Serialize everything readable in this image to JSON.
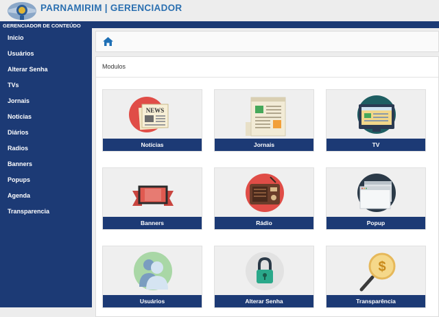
{
  "header": {
    "title": "PARNAMIRIM | GERENCIADOR"
  },
  "sidebar": {
    "title": "GERENCIADOR DE CONTEÚDO",
    "items": [
      {
        "label": "Inicio"
      },
      {
        "label": "Usuários"
      },
      {
        "label": "Alterar Senha"
      },
      {
        "label": "TVs"
      },
      {
        "label": "Jornais"
      },
      {
        "label": "Noticias"
      },
      {
        "label": "Diários"
      },
      {
        "label": "Radios"
      },
      {
        "label": "Banners"
      },
      {
        "label": "Popups"
      },
      {
        "label": "Agenda"
      },
      {
        "label": "Transparencia"
      }
    ]
  },
  "breadcrumb": {
    "icon": "home-icon"
  },
  "modules": {
    "title": "Modulos",
    "cards": [
      {
        "label": "Notícias",
        "icon": "newspaper-news-icon"
      },
      {
        "label": "Jornais",
        "icon": "journal-icon"
      },
      {
        "label": "TV",
        "icon": "tv-icon"
      },
      {
        "label": "Banners",
        "icon": "banner-icon"
      },
      {
        "label": "Rádio",
        "icon": "radio-icon"
      },
      {
        "label": "Popup",
        "icon": "popup-window-icon"
      },
      {
        "label": "Usuários",
        "icon": "users-icon"
      },
      {
        "label": "Alterar Senha",
        "icon": "padlock-icon"
      },
      {
        "label": "Transparência",
        "icon": "money-magnifier-icon"
      }
    ]
  },
  "colors": {
    "accent": "#1c3a75",
    "title": "#2a6fb0",
    "background": "#ededed"
  }
}
